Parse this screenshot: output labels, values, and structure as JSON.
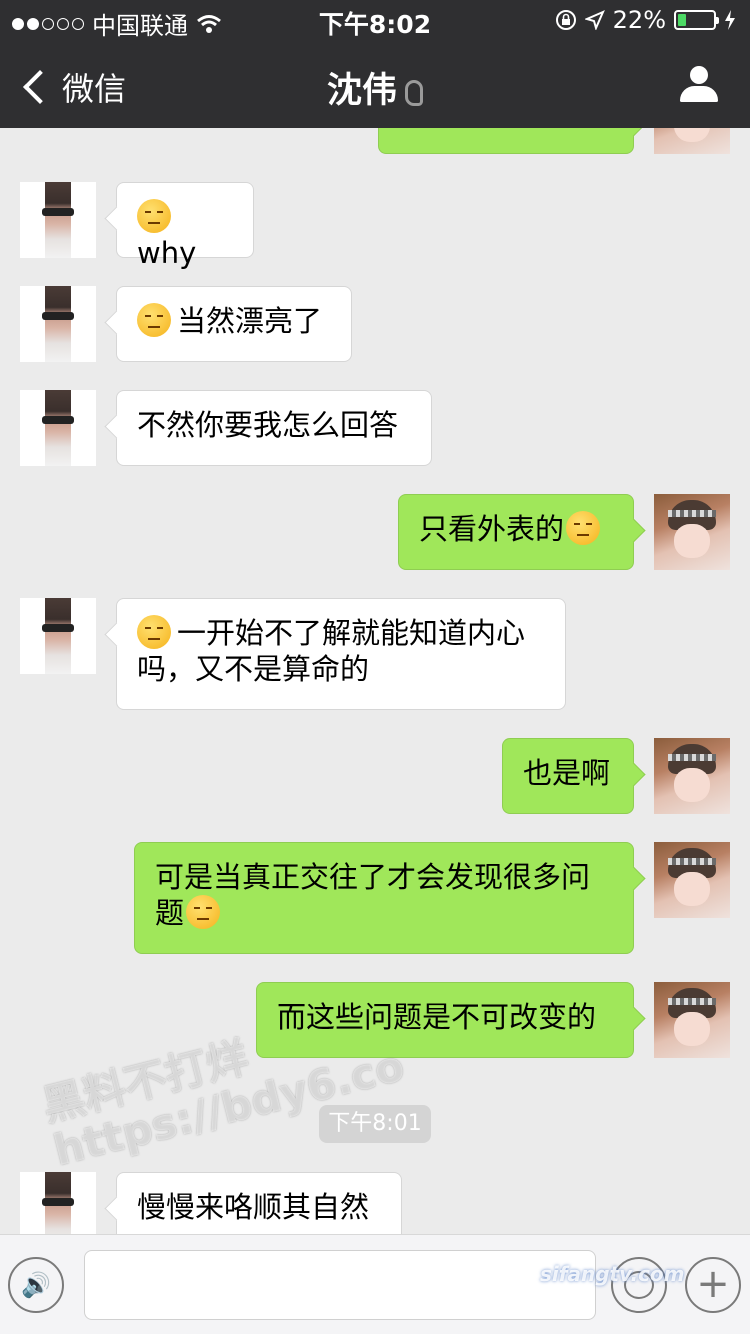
{
  "status_bar": {
    "carrier": "中国联通",
    "time": "下午8:02",
    "battery_percent": "22%"
  },
  "nav": {
    "back_label": "微信",
    "title": "沈伟"
  },
  "messages": [
    {
      "from": "me",
      "text": ""
    },
    {
      "from": "contact",
      "text": "why",
      "emoji": "unamused"
    },
    {
      "from": "contact",
      "text": "当然漂亮了",
      "emoji": "unamused"
    },
    {
      "from": "contact",
      "text": "不然你要我怎么回答"
    },
    {
      "from": "me",
      "text": "只看外表的",
      "emoji": "pensive"
    },
    {
      "from": "contact",
      "text": "一开始不了解就能知道内心吗，又不是算命的",
      "emoji": "unamused"
    },
    {
      "from": "me",
      "text": "也是啊"
    },
    {
      "from": "me",
      "text": "可是当真正交往了才会发现很多问题",
      "emoji": "relieved"
    },
    {
      "from": "me",
      "text": "而这些问题是不可改变的"
    },
    {
      "from": "contact",
      "text": "慢慢来咯顺其自然"
    }
  ],
  "timestamp": "下午8:01",
  "watermark": {
    "line1": "黑料不打烊",
    "line2": "https://bdy6.co",
    "corner": "sifangtv.com"
  },
  "icons": [
    "signal-dots-icon",
    "wifi-icon",
    "lock-rotation-icon",
    "location-arrow-icon",
    "battery-icon",
    "charging-icon",
    "back-chevron-icon",
    "ear-icon",
    "person-icon",
    "voice-icon",
    "emoji-icon",
    "plus-icon"
  ]
}
